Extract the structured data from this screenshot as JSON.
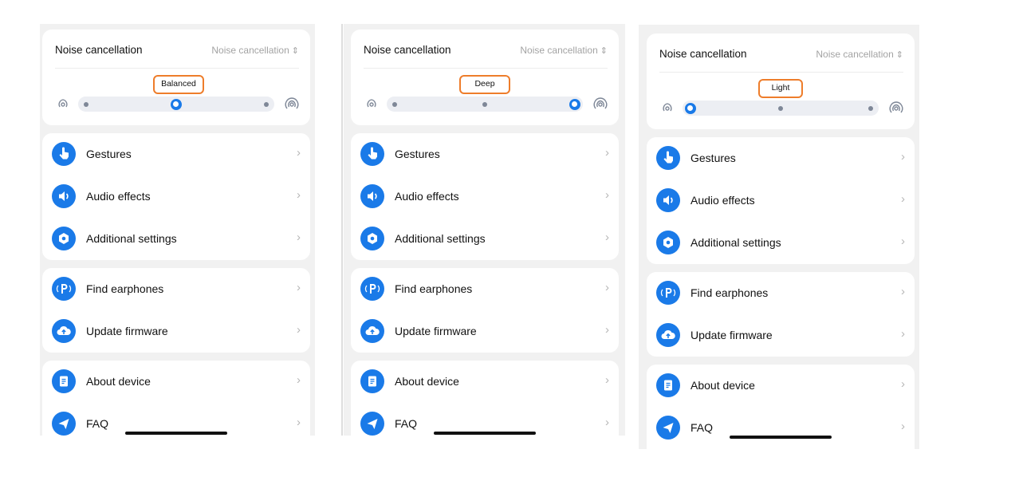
{
  "nc_title": "Noise cancellation",
  "nc_mode": "Noise cancellation",
  "nc_chevron": "⌃⌄",
  "arrow": "›",
  "icons": {
    "gestures": "hand-pointer-icon",
    "audio_effects": "speaker-icon",
    "additional_settings": "gear-icon",
    "find_earphones": "locate-earphones-icon",
    "update_firmware": "cloud-upload-icon",
    "about_device": "document-icon",
    "faq": "send-icon",
    "anc_low": "anc-low-icon",
    "anc_high": "anc-high-icon"
  },
  "colors": {
    "accent": "#1a7ae8",
    "highlight": "#ee7d2b",
    "dot": "#7e8797"
  },
  "screens": [
    {
      "mode_label": "Balanced",
      "selected_level": 1,
      "menu": [
        "Gestures",
        "Audio effects",
        "Additional settings"
      ],
      "tools": [
        "Find earphones",
        "Update firmware"
      ],
      "info": [
        "About device",
        "FAQ"
      ]
    },
    {
      "mode_label": "Deep",
      "selected_level": 2,
      "menu": [
        "Gestures",
        "Audio effects",
        "Additional settings"
      ],
      "tools": [
        "Find earphones",
        "Update firmware"
      ],
      "info": [
        "About device",
        "FAQ"
      ]
    },
    {
      "mode_label": "Light",
      "selected_level": 0,
      "menu": [
        "Gestures",
        "Audio effects",
        "Additional settings"
      ],
      "tools": [
        "Find earphones",
        "Update firmware"
      ],
      "info": [
        "About device",
        "FAQ"
      ]
    }
  ]
}
